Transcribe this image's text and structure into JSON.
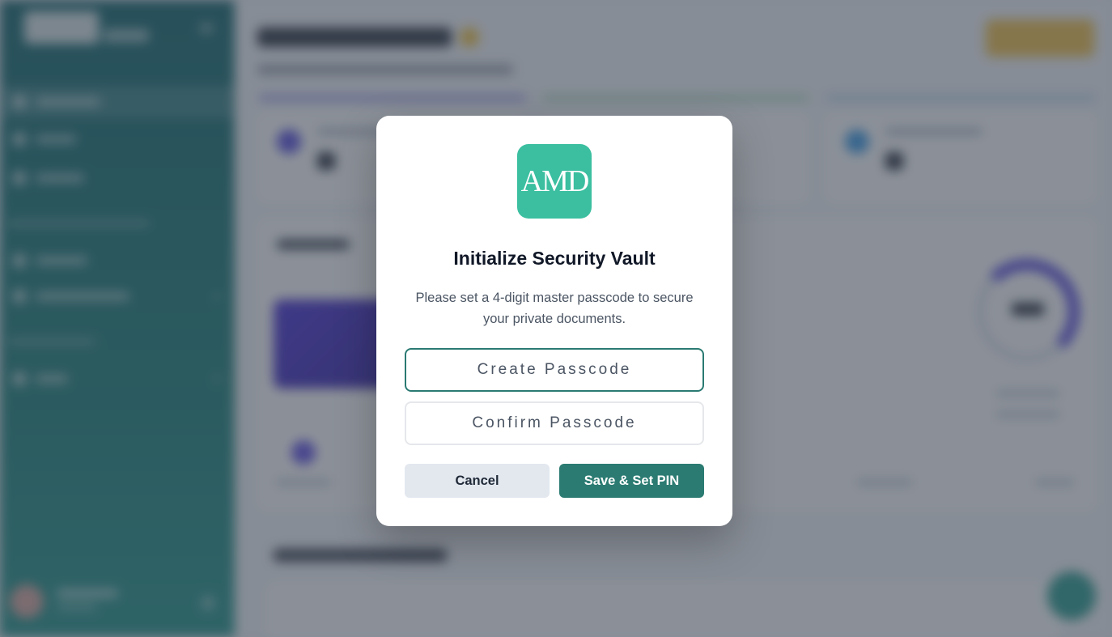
{
  "modal": {
    "logo_text": "AMD",
    "title": "Initialize Security Vault",
    "description": "Please set a 4-digit master passcode to secure your private documents.",
    "passcode_placeholder": "Create Passcode",
    "confirm_placeholder": "Confirm Passcode",
    "cancel_label": "Cancel",
    "save_label": "Save & Set PIN"
  },
  "colors": {
    "accent": "#2b7b72",
    "logo_bg": "#3bbfa0",
    "sidebar": "#1b8078",
    "overlay": "rgba(55,63,78,0.58)"
  },
  "icons": {
    "logo": "amd-logo-icon"
  }
}
